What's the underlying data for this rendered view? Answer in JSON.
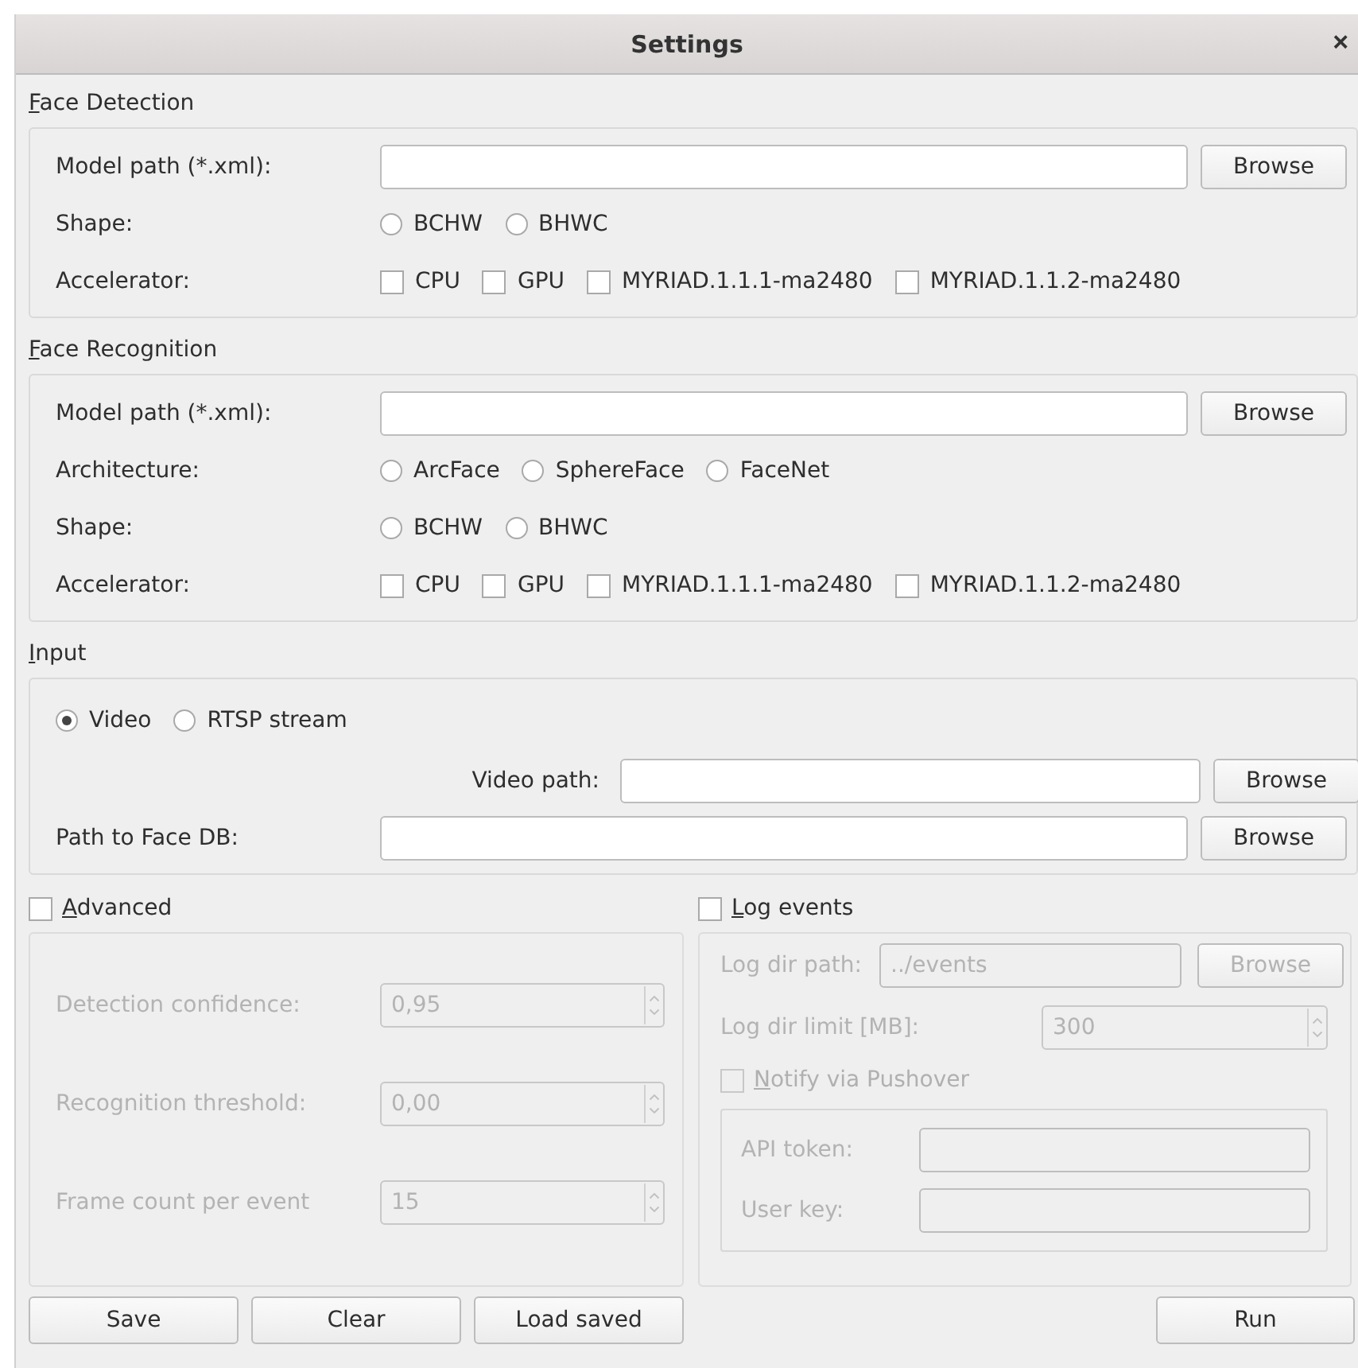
{
  "window": {
    "title": "Settings",
    "close": "×"
  },
  "face_detection": {
    "title": "Face Detection",
    "rows": [
      {
        "kind": "path",
        "label": "Model path (*.xml):",
        "button": "Browse"
      },
      {
        "kind": "radio",
        "label": "Shape:",
        "options": [
          {
            "label": "BCHW",
            "selected": false
          },
          {
            "label": "BHWC",
            "selected": false
          }
        ]
      },
      {
        "kind": "check",
        "label": "Accelerator:",
        "options": [
          {
            "label": "CPU",
            "checked": false
          },
          {
            "label": "GPU",
            "checked": false
          },
          {
            "label": "MYRIAD.1.1.1-ma2480",
            "checked": false
          },
          {
            "label": "MYRIAD.1.1.2-ma2480",
            "checked": false
          }
        ]
      }
    ]
  },
  "face_recognition": {
    "title": "Face Recognition",
    "rows": [
      {
        "kind": "path",
        "label": "Model path (*.xml):",
        "button": "Browse"
      },
      {
        "kind": "radio",
        "label": "Architecture:",
        "options": [
          {
            "label": "ArcFace",
            "selected": false
          },
          {
            "label": "SphereFace",
            "selected": false
          },
          {
            "label": "FaceNet",
            "selected": false
          }
        ]
      },
      {
        "kind": "radio",
        "label": "Shape:",
        "options": [
          {
            "label": "BCHW",
            "selected": false
          },
          {
            "label": "BHWC",
            "selected": false
          }
        ]
      },
      {
        "kind": "check",
        "label": "Accelerator:",
        "options": [
          {
            "label": "CPU",
            "checked": false
          },
          {
            "label": "GPU",
            "checked": false
          },
          {
            "label": "MYRIAD.1.1.1-ma2480",
            "checked": false
          },
          {
            "label": "MYRIAD.1.1.2-ma2480",
            "checked": false
          }
        ]
      }
    ]
  },
  "input": {
    "title": "Input",
    "rows": [
      {
        "kind": "radio_only",
        "options": [
          {
            "label": "Video",
            "selected": true
          },
          {
            "label": "RTSP stream",
            "selected": false
          }
        ]
      },
      {
        "kind": "path_right",
        "label": "Video path:",
        "button": "Browse"
      },
      {
        "kind": "path",
        "label": "Path to Face DB:",
        "button": "Browse"
      }
    ]
  },
  "advanced": {
    "label": "Advanced",
    "checked": false,
    "fields": [
      {
        "label": "Detection confidence:",
        "value": "0,95"
      },
      {
        "label": "Recognition threshold:",
        "value": "0,00"
      },
      {
        "label": "Frame count per event",
        "value": "15"
      }
    ]
  },
  "log_events": {
    "label": "Log events",
    "checked": false,
    "dir_path": {
      "label": "Log dir path:",
      "value": "../events",
      "button": "Browse"
    },
    "dir_limit": {
      "label": "Log dir limit [MB]:",
      "value": "300"
    },
    "pushover": {
      "label": "Notify via Pushover",
      "checked": false,
      "fields": [
        {
          "label": "API token:"
        },
        {
          "label": "User key:"
        }
      ]
    }
  },
  "buttons": {
    "left": [
      "Save",
      "Clear",
      "Load saved"
    ],
    "right": [
      "Run"
    ]
  }
}
